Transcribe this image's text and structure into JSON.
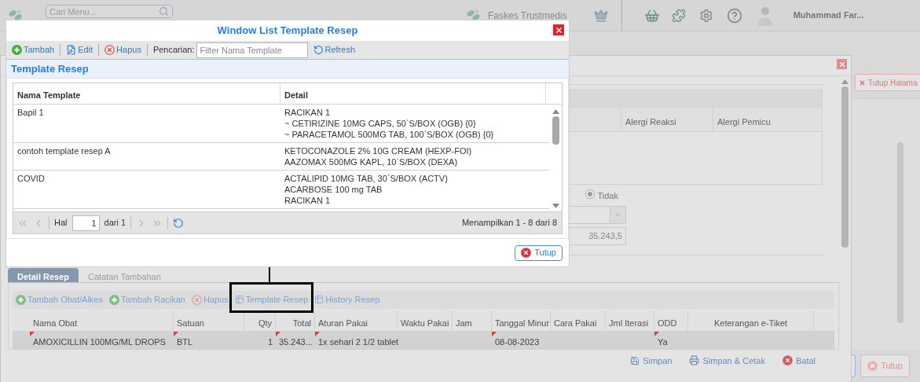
{
  "top_bar": {
    "search": {
      "placeholder": "Cari Menu..."
    },
    "facility": "Faskes Trustmedis",
    "user": "Muhammad Far..."
  },
  "page": {
    "close_page_button": "Tutup Halama",
    "close_button": "Tutup"
  },
  "back_window": {
    "allergy_columns": [
      "Alergi Reaksi",
      "Alergi Pemicu"
    ],
    "radio": {
      "label": "Tidak",
      "selected": true
    },
    "amount_field": {
      "value": "35.243,5"
    },
    "tabs": [
      {
        "label": "Detail Resep",
        "selected": true
      },
      {
        "label": "Catatan Tambahan",
        "selected": false
      }
    ],
    "toolbar": [
      {
        "label": "Tambah Obat/Alkes",
        "kind": "add",
        "highlighted": false
      },
      {
        "label": "Tambah Racikan",
        "kind": "add",
        "highlighted": false
      },
      {
        "label": "Hapus",
        "kind": "delete",
        "highlighted": false
      },
      {
        "label": "Template Resep",
        "kind": "grid",
        "highlighted": true
      },
      {
        "label": "History Resep",
        "kind": "grid",
        "highlighted": false
      }
    ],
    "table": {
      "columns": [
        "Nama Obat",
        "Satuan",
        "Qty",
        "Total",
        "Aturan Pakai",
        "Waktu Pakai",
        "Jam",
        "Tanggal Minur",
        "Cara Pakai",
        "Jml Iterasi",
        "ODD",
        "Keterangan e-Tiket"
      ],
      "rows": [
        {
          "nama_obat": {
            "text": "AMOXICILLIN 100MG/ML DROPS",
            "edited": true
          },
          "satuan": {
            "text": "BTL",
            "edited": true
          },
          "qty": {
            "text": "1",
            "edited": false
          },
          "total": {
            "text": "35.243...",
            "edited": true
          },
          "aturan_pakai": {
            "text": "1x sehari 2 1/2 tablet",
            "edited": true
          },
          "tanggal_minum": {
            "text": "08-08-2023",
            "edited": true
          },
          "odd": {
            "text": "Ya",
            "edited": true
          }
        }
      ]
    },
    "footer_buttons": [
      {
        "label": "Simpan",
        "kind": "save"
      },
      {
        "label": "Simpan & Cetak",
        "kind": "print"
      },
      {
        "label": "Batal",
        "kind": "cancel"
      }
    ]
  },
  "modal": {
    "title": "Window List Template Resep",
    "toolbar": [
      {
        "label": "Tambah",
        "kind": "add"
      },
      {
        "label": "Edit",
        "kind": "edit"
      },
      {
        "label": "Hapus",
        "kind": "delete"
      }
    ],
    "search": {
      "label": "Pencarian:",
      "placeholder": "Filter Nama Template"
    },
    "refresh": "Refresh",
    "panel_title": "Template Resep",
    "table": {
      "columns": [
        "Nama Template",
        "Detail"
      ],
      "rows": [
        {
          "name": "Bapil 1",
          "detail": [
            "RACIKAN 1",
            "~ CETIRIZINE 10MG CAPS, 50`S/BOX (OGB) {0}",
            "~ PARACETAMOL 500MG TAB, 100`S/BOX (OGB) {0}"
          ]
        },
        {
          "name": "contoh template resep A",
          "detail": [
            "KETOCONAZOLE 2% 10G CREAM (HEXP-FOI)",
            "AAZOMAX 500MG KAPL, 10`S/BOX (DEXA)"
          ]
        },
        {
          "name": "COVID",
          "detail": [
            "ACTALIPID 10MG TAB, 30`S/BOX (ACTV)",
            "ACARBOSE 100 mg TAB",
            "RACIKAN 1"
          ]
        }
      ]
    },
    "pager": {
      "nav": [
        {
          "kind": "first",
          "disabled": true
        },
        {
          "kind": "prev",
          "disabled": true
        },
        {
          "kind": "next",
          "disabled": true
        },
        {
          "kind": "last",
          "disabled": true
        }
      ],
      "page_label": "Hal",
      "page": "1",
      "of": "dari 1",
      "summary": "Menampilkan 1 - 8 dari 8"
    },
    "close_button": "Tutup"
  }
}
